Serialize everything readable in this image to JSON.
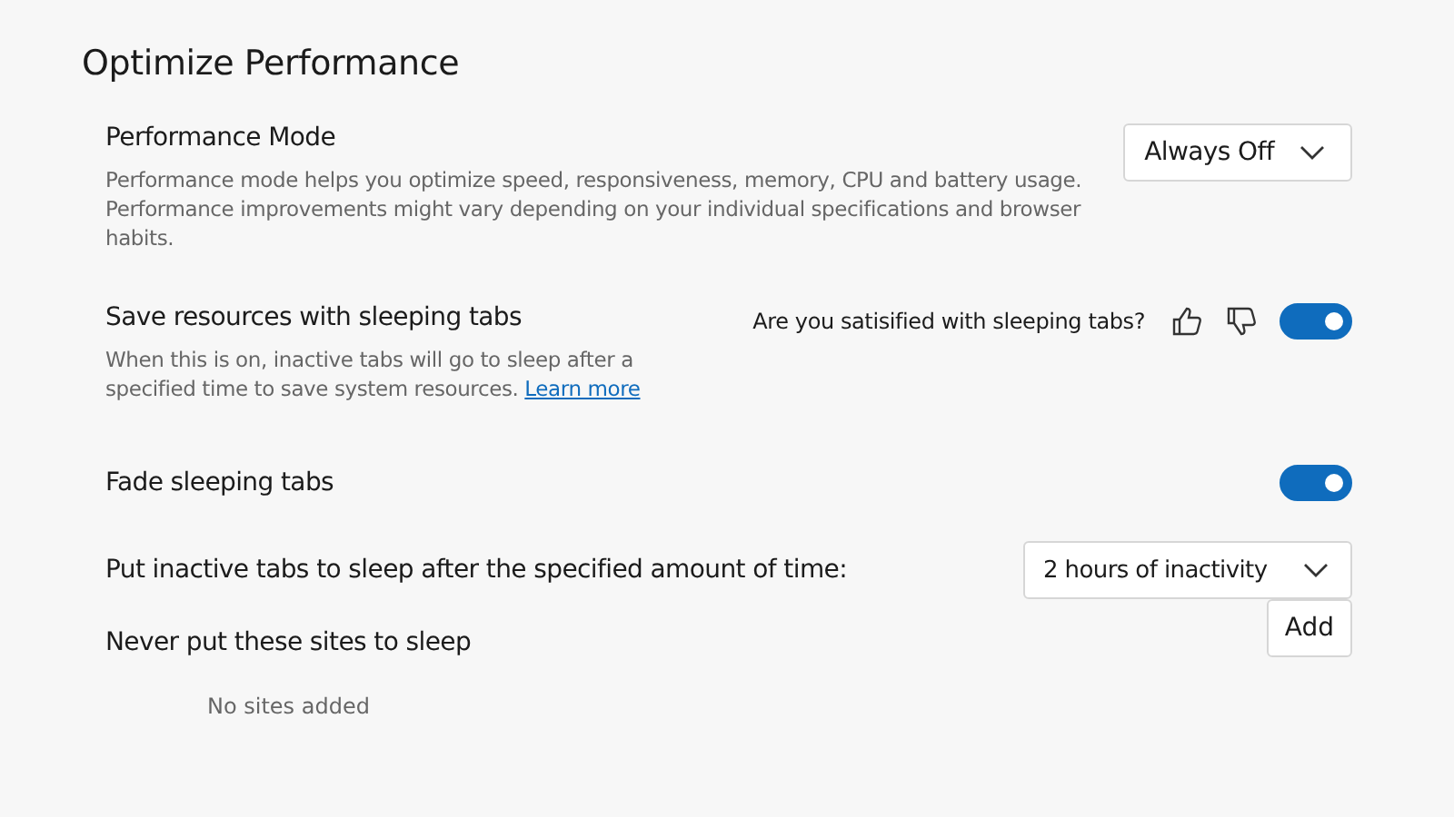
{
  "title": "Optimize Performance",
  "performance_mode": {
    "label": "Performance Mode",
    "description": "Performance mode helps you optimize speed, responsiveness, memory, CPU and battery usage. Performance improvements might vary depending on your individual specifications and browser habits.",
    "dropdown": "Always Off"
  },
  "sleeping_tabs": {
    "label": "Save resources with sleeping tabs",
    "description": "When this is on, inactive tabs will go to sleep after a specified time to save system resources.",
    "link": "Learn more",
    "feedback": "Are you satisified with sleeping tabs?",
    "on": true
  },
  "fade_sleeping_tabs": {
    "label": "Fade sleeping tabs",
    "on": true
  },
  "sleep_after": {
    "label": "Put inactive tabs to sleep after the specified amount of time:",
    "dropdown": "2 hours of inactivity"
  },
  "never_sleep": {
    "label": "Never put these sites to sleep",
    "button": "Add",
    "empty": "No sites added"
  }
}
